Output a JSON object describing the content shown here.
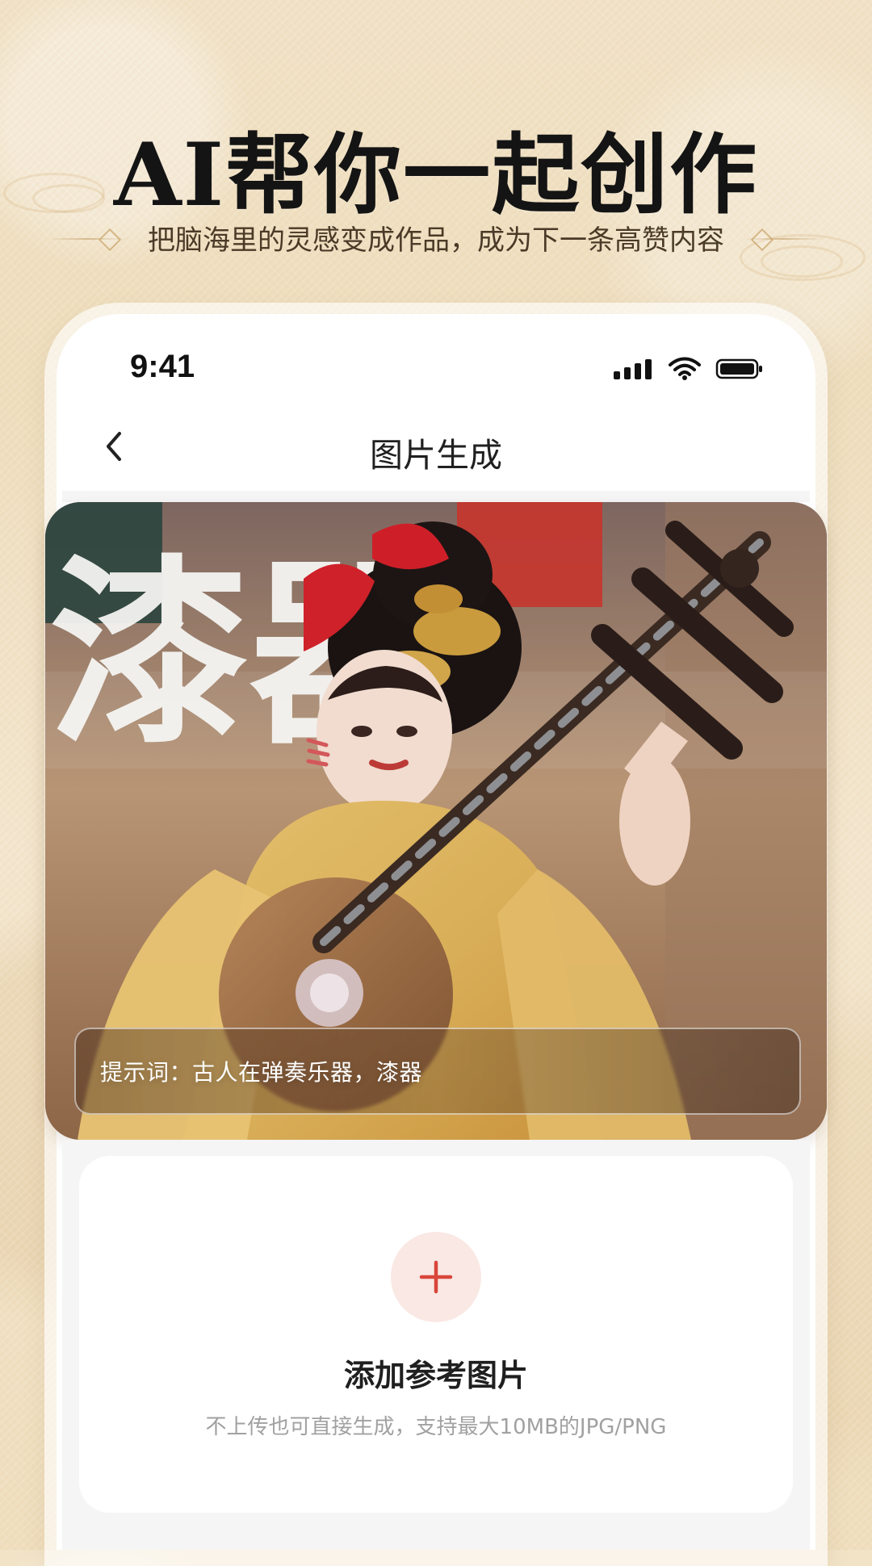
{
  "promo": {
    "title": "AI帮你一起创作",
    "subtitle": "把脑海里的灵感变成作品，成为下一条高赞内容"
  },
  "status_bar": {
    "time": "9:41",
    "icons": [
      "signal-icon",
      "wifi-icon",
      "battery-icon"
    ]
  },
  "navigation": {
    "title": "图片生成",
    "back_icon": "chevron-left-icon"
  },
  "hero": {
    "overlay_text": "漆器",
    "prompt_label": "提示词：古人在弹奏乐器，漆器"
  },
  "upload": {
    "title": "添加参考图片",
    "hint": "不上传也可直接生成，支持最大10MB的JPG/PNG",
    "icon": "plus-icon"
  },
  "colors": {
    "background": "#efdfbf",
    "accent_red": "#d9463b",
    "upload_icon_bg": "#f9e8e3",
    "muted_text": "#a1a1a1"
  }
}
